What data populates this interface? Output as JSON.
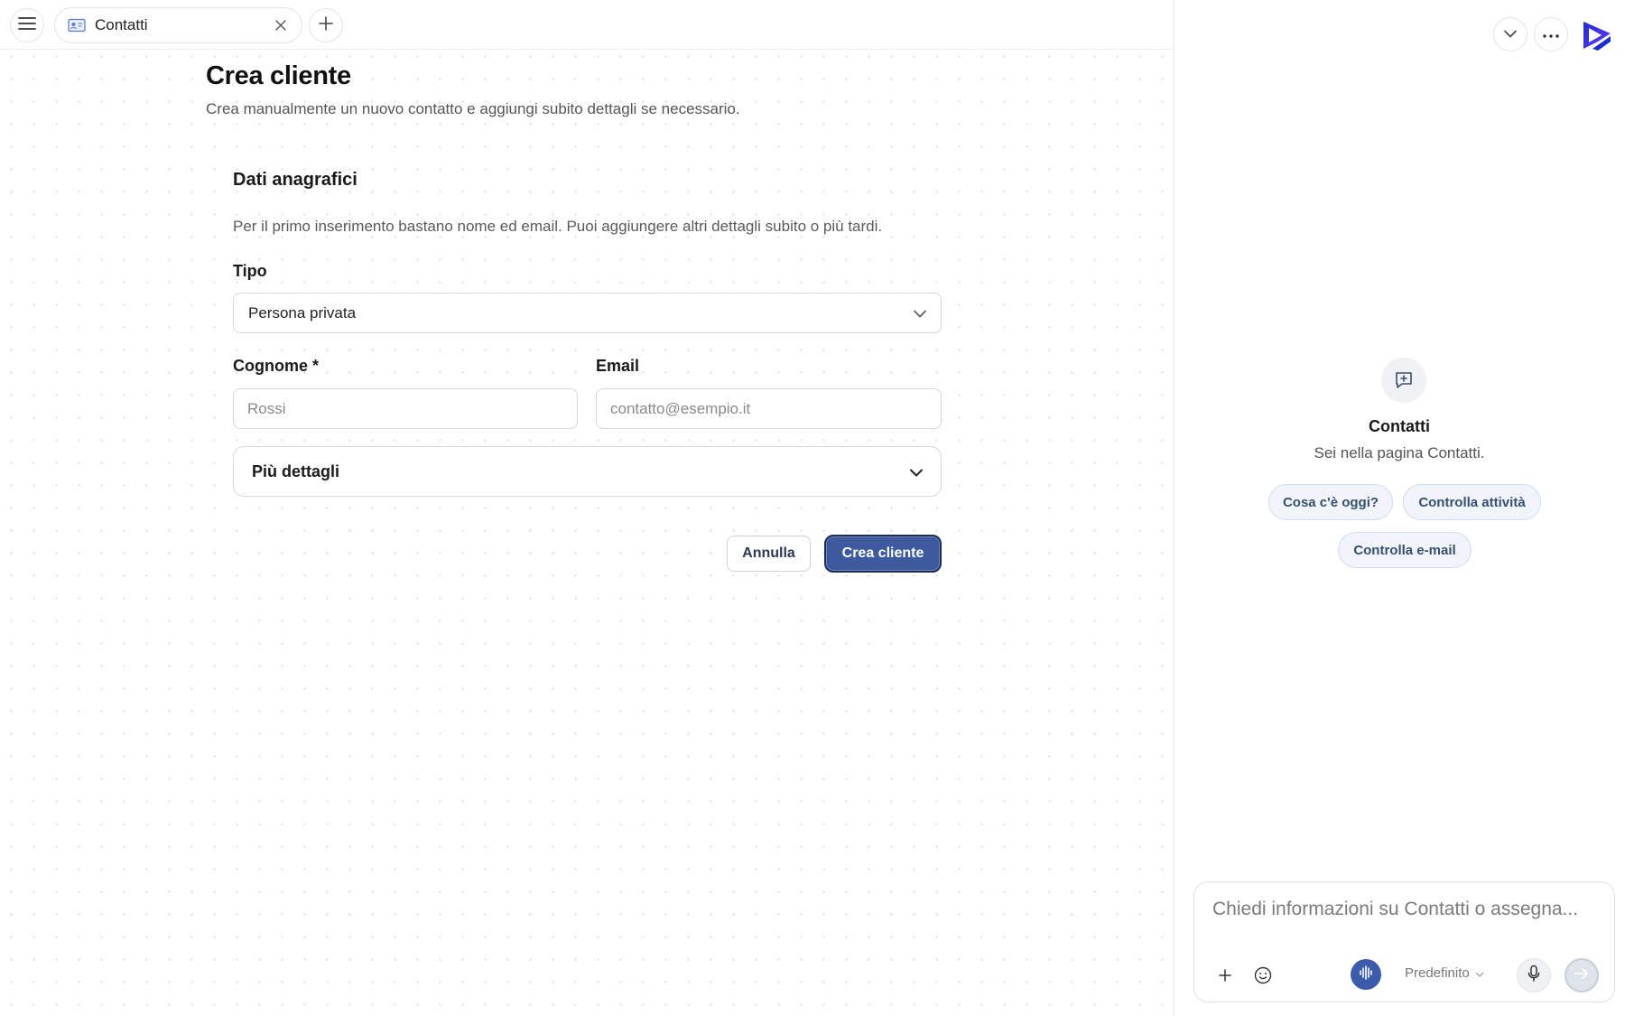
{
  "topbar": {
    "tab": {
      "label": "Contatti",
      "icon": "contacts-card-icon"
    },
    "menu_icon": "hamburger-menu-icon",
    "close_icon": "close-icon",
    "new_tab_icon": "plus-icon"
  },
  "form": {
    "title": "Crea cliente",
    "subtitle": "Crea manualmente un nuovo contatto e aggiungi subito dettagli se necessario.",
    "section_title": "Dati anagrafici",
    "section_description": "Per il primo inserimento bastano nome ed email. Puoi aggiungere altri dettagli subito o più tardi.",
    "type_label": "Tipo",
    "type_value": "Persona privata",
    "surname_label": "Cognome *",
    "surname_placeholder": "Rossi",
    "email_label": "Email",
    "email_placeholder": "contatto@esempio.it",
    "more_details_label": "Più dettagli",
    "cancel_label": "Annulla",
    "submit_label": "Crea cliente"
  },
  "assistant": {
    "collapse_icon": "chevron-down-icon",
    "more_icon": "more-horizontal-icon",
    "logo_icon": "brand-logo-icon",
    "empty_icon": "chat-plus-icon",
    "title": "Contatti",
    "subtitle": "Sei nella pagina Contatti.",
    "suggestions": [
      "Cosa c'è oggi?",
      "Controlla attività",
      "Controlla e-mail"
    ],
    "composer": {
      "placeholder": "Chiedi informazioni su Contatti o assegna...",
      "model_label": "Predefinito",
      "attach_icon": "plus-icon",
      "emoji_icon": "emoji-icon",
      "voice_icon": "voice-waveform-icon",
      "mic_icon": "microphone-icon",
      "send_icon": "arrow-right-icon"
    }
  },
  "colors": {
    "primary": "#3d5a9e",
    "primary_border": "#1f2d52",
    "chip_bg": "#f1f5fb",
    "chip_text": "#364f71"
  }
}
